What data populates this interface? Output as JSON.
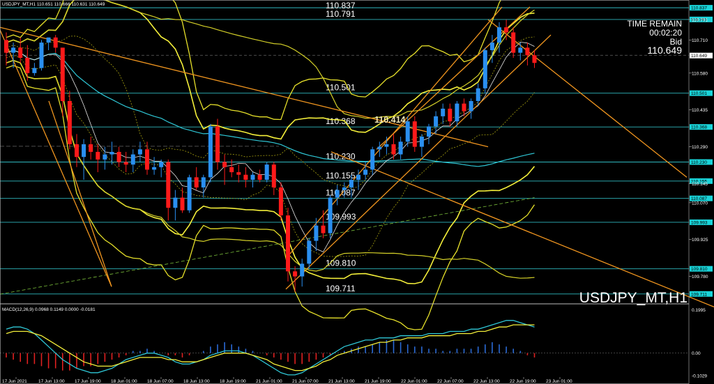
{
  "chart_data": {
    "type": "candlestick",
    "symbol_header": "USDJPY_MT,H1  110.651 110.666 110.631 110.649",
    "symbol_watermark": "USDJPY_MT,H1",
    "ylim": [
      109.683,
      110.862
    ],
    "time_remain": {
      "title": "TIME REMAIN",
      "value": "00:02:20",
      "label": "Bid",
      "bid": "110.649"
    },
    "price_ticks": [
      "110.791",
      "110.710",
      "110.580",
      "110.435",
      "110.290",
      "110.145",
      "110.070",
      "109.925",
      "109.780"
    ],
    "x_ticks": [
      "17 Jun 2021",
      "17 Jun 13:00",
      "17 Jun 19:00",
      "18 Jun 01:00",
      "18 Jun 07:00",
      "18 Jun 13:00",
      "18 Jun 19:00",
      "21 Jun 01:00",
      "21 Jun 07:00",
      "21 Jun 13:00",
      "21 Jun 19:00",
      "22 Jun 01:00",
      "22 Jun 07:00",
      "22 Jun 13:00",
      "22 Jun 19:00",
      "23 Jun 01:00"
    ],
    "levels": [
      {
        "value": 110.837,
        "label": "110.837",
        "tag": "110.837"
      },
      {
        "value": 110.791,
        "label": "110.791",
        "tag": "110.791"
      },
      {
        "value": 110.501,
        "label": "110.501",
        "tag": "110.501"
      },
      {
        "value": 110.368,
        "label": "110.368",
        "tag": "110.368"
      },
      {
        "value": 110.23,
        "label": "110.230",
        "tag": "110.230"
      },
      {
        "value": 110.155,
        "label": "110.155",
        "tag": "110.155"
      },
      {
        "value": 110.087,
        "label": "110.087",
        "tag": "110.087"
      },
      {
        "value": 109.993,
        "label": "109.993",
        "tag": "109.993"
      },
      {
        "value": 109.81,
        "label": "109.810",
        "tag": "109.810"
      },
      {
        "value": 109.711,
        "label": "109.711",
        "tag": "109.711"
      }
    ],
    "current_price_tag": "110.649",
    "current_price": 110.649,
    "highlight_label": "110.414",
    "highlight_price": 110.414,
    "candles_ohlc": [
      [
        110.71,
        110.74,
        110.61,
        110.66
      ],
      [
        110.66,
        110.7,
        110.6,
        110.68
      ],
      [
        110.68,
        110.72,
        110.62,
        110.64
      ],
      [
        110.64,
        110.69,
        110.55,
        110.58
      ],
      [
        110.58,
        110.62,
        110.57,
        110.6
      ],
      [
        110.6,
        110.71,
        110.59,
        110.7
      ],
      [
        110.7,
        110.72,
        110.67,
        110.72
      ],
      [
        110.72,
        110.73,
        110.66,
        110.68
      ],
      [
        110.68,
        110.68,
        110.41,
        110.47
      ],
      [
        110.47,
        110.51,
        110.28,
        110.3
      ],
      [
        110.3,
        110.34,
        110.21,
        110.25
      ],
      [
        110.25,
        110.32,
        110.16,
        110.3
      ],
      [
        110.3,
        110.33,
        110.24,
        110.27
      ],
      [
        110.27,
        110.3,
        110.19,
        110.24
      ],
      [
        110.24,
        110.29,
        110.2,
        110.26
      ],
      [
        110.26,
        110.31,
        110.22,
        110.27
      ],
      [
        110.27,
        110.29,
        110.21,
        110.23
      ],
      [
        110.23,
        110.27,
        110.19,
        110.22
      ],
      [
        110.22,
        110.28,
        110.19,
        110.26
      ],
      [
        110.26,
        110.31,
        110.23,
        110.28
      ],
      [
        110.28,
        110.31,
        110.18,
        110.2
      ],
      [
        110.2,
        110.25,
        110.18,
        110.21
      ],
      [
        110.21,
        110.24,
        110.17,
        110.23
      ],
      [
        110.23,
        110.24,
        110.0,
        110.05
      ],
      [
        110.05,
        110.12,
        110.0,
        110.09
      ],
      [
        110.09,
        110.13,
        110.03,
        110.04
      ],
      [
        110.04,
        110.18,
        110.03,
        110.17
      ],
      [
        110.17,
        110.21,
        110.12,
        110.13
      ],
      [
        110.13,
        110.18,
        110.09,
        110.17
      ],
      [
        110.17,
        110.38,
        110.15,
        110.37
      ],
      [
        110.37,
        110.4,
        110.2,
        110.23
      ],
      [
        110.23,
        110.26,
        110.14,
        110.21
      ],
      [
        110.21,
        110.24,
        110.17,
        110.19
      ],
      [
        110.19,
        110.22,
        110.15,
        110.18
      ],
      [
        110.18,
        110.21,
        110.13,
        110.16
      ],
      [
        110.16,
        110.19,
        110.13,
        110.18
      ],
      [
        110.18,
        110.2,
        110.15,
        110.16
      ],
      [
        110.16,
        110.23,
        110.15,
        110.22
      ],
      [
        110.22,
        110.23,
        110.1,
        110.13
      ],
      [
        110.13,
        110.15,
        110.0,
        110.02
      ],
      [
        110.02,
        110.05,
        109.76,
        109.8
      ],
      [
        109.8,
        109.82,
        109.72,
        109.78
      ],
      [
        109.78,
        109.85,
        109.74,
        109.83
      ],
      [
        109.83,
        109.93,
        109.81,
        109.92
      ],
      [
        109.92,
        110.01,
        109.88,
        109.98
      ],
      [
        109.98,
        110.04,
        109.93,
        109.95
      ],
      [
        109.95,
        110.1,
        109.93,
        110.09
      ],
      [
        110.09,
        110.14,
        110.06,
        110.12
      ],
      [
        110.12,
        110.15,
        110.09,
        110.13
      ],
      [
        110.13,
        110.18,
        110.09,
        110.16
      ],
      [
        110.16,
        110.2,
        110.12,
        110.18
      ],
      [
        110.18,
        110.23,
        110.16,
        110.2
      ],
      [
        110.2,
        110.29,
        110.18,
        110.28
      ],
      [
        110.28,
        110.31,
        110.25,
        110.29
      ],
      [
        110.29,
        110.33,
        110.26,
        110.3
      ],
      [
        110.3,
        110.34,
        110.24,
        110.26
      ],
      [
        110.26,
        110.33,
        110.24,
        110.31
      ],
      [
        110.31,
        110.41,
        110.29,
        110.39
      ],
      [
        110.39,
        110.41,
        110.27,
        110.29
      ],
      [
        110.29,
        110.34,
        110.25,
        110.33
      ],
      [
        110.33,
        110.38,
        110.3,
        110.37
      ],
      [
        110.37,
        110.43,
        110.34,
        110.41
      ],
      [
        110.41,
        110.46,
        110.38,
        110.44
      ],
      [
        110.44,
        110.46,
        110.37,
        110.39
      ],
      [
        110.39,
        110.47,
        110.37,
        110.46
      ],
      [
        110.46,
        110.48,
        110.41,
        110.43
      ],
      [
        110.43,
        110.48,
        110.4,
        110.47
      ],
      [
        110.47,
        110.54,
        110.45,
        110.52
      ],
      [
        110.52,
        110.68,
        110.5,
        110.67
      ],
      [
        110.67,
        110.73,
        110.62,
        110.7
      ],
      [
        110.7,
        110.78,
        110.66,
        110.76
      ],
      [
        110.76,
        110.79,
        110.71,
        110.74
      ],
      [
        110.74,
        110.76,
        110.64,
        110.66
      ],
      [
        110.66,
        110.7,
        110.63,
        110.68
      ],
      [
        110.68,
        110.7,
        110.61,
        110.65
      ],
      [
        110.65,
        110.67,
        110.6,
        110.62
      ]
    ],
    "macd_header": "MACD(12,26,9) 0.0968 0.1149 0.0000 -0.0181",
    "macd_ylim": [
      -0.11,
      0.22
    ],
    "macd_ticks": [
      "0.1995",
      "0.00",
      "-0.1029"
    ],
    "macd_histogram": [
      -0.02,
      -0.03,
      -0.04,
      -0.05,
      -0.05,
      -0.06,
      -0.07,
      -0.07,
      -0.08,
      -0.08,
      -0.07,
      -0.06,
      -0.06,
      -0.05,
      -0.04,
      -0.03,
      -0.02,
      -0.01,
      0.01,
      0.01,
      0.02,
      0.01,
      0.0,
      -0.01,
      -0.01,
      -0.02,
      -0.01,
      0.0,
      0.01,
      0.03,
      0.04,
      0.05,
      0.04,
      0.03,
      0.02,
      0.01,
      0.0,
      -0.01,
      -0.02,
      -0.03,
      -0.04,
      -0.05,
      -0.05,
      -0.04,
      -0.03,
      -0.02,
      -0.01,
      0.0,
      0.01,
      0.02,
      0.03,
      0.03,
      0.04,
      0.05,
      0.06,
      0.06,
      0.05,
      0.04,
      0.03,
      0.03,
      0.02,
      0.02,
      0.01,
      0.01,
      0.02,
      0.02,
      0.02,
      0.03,
      0.04,
      0.05,
      0.04,
      0.03,
      0.02,
      0.01,
      -0.01,
      -0.02
    ],
    "macd_line": [
      0.11,
      0.12,
      0.12,
      0.11,
      0.09,
      0.06,
      0.03,
      0.0,
      -0.03,
      -0.05,
      -0.07,
      -0.08,
      -0.09,
      -0.09,
      -0.08,
      -0.07,
      -0.05,
      -0.03,
      -0.02,
      -0.01,
      0.0,
      0.0,
      -0.01,
      -0.02,
      -0.04,
      -0.05,
      -0.05,
      -0.04,
      -0.03,
      -0.01,
      0.0,
      0.01,
      0.01,
      0.01,
      0.0,
      -0.01,
      -0.03,
      -0.05,
      -0.07,
      -0.09,
      -0.1,
      -0.1,
      -0.09,
      -0.07,
      -0.05,
      -0.03,
      -0.01,
      0.01,
      0.03,
      0.04,
      0.05,
      0.06,
      0.06,
      0.07,
      0.07,
      0.07,
      0.08,
      0.08,
      0.08,
      0.08,
      0.09,
      0.09,
      0.09,
      0.1,
      0.1,
      0.1,
      0.11,
      0.11,
      0.12,
      0.13,
      0.14,
      0.15,
      0.15,
      0.14,
      0.13,
      0.12
    ],
    "signal_line": [
      0.09,
      0.1,
      0.1,
      0.1,
      0.09,
      0.08,
      0.06,
      0.04,
      0.02,
      0.0,
      -0.02,
      -0.04,
      -0.05,
      -0.06,
      -0.06,
      -0.06,
      -0.05,
      -0.04,
      -0.03,
      -0.02,
      -0.02,
      -0.02,
      -0.02,
      -0.03,
      -0.03,
      -0.04,
      -0.04,
      -0.04,
      -0.03,
      -0.02,
      -0.01,
      0.0,
      0.0,
      0.0,
      0.0,
      -0.01,
      -0.02,
      -0.03,
      -0.05,
      -0.06,
      -0.07,
      -0.08,
      -0.08,
      -0.07,
      -0.06,
      -0.04,
      -0.03,
      -0.01,
      0.0,
      0.01,
      0.02,
      0.03,
      0.04,
      0.05,
      0.05,
      0.06,
      0.06,
      0.07,
      0.07,
      0.07,
      0.08,
      0.08,
      0.08,
      0.08,
      0.09,
      0.09,
      0.09,
      0.1,
      0.1,
      0.11,
      0.12,
      0.12,
      0.13,
      0.13,
      0.13,
      0.13
    ]
  }
}
